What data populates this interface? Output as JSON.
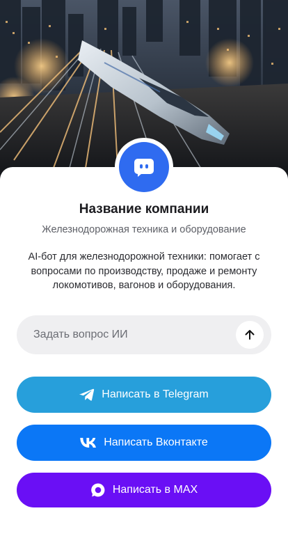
{
  "company": {
    "name": "Название компании",
    "subtitle": "Железнодорожная техника и оборудование",
    "description": "AI-бот для железнодорожной техники: помогает с вопросами по производству, продаже и ремонту локомотивов, вагонов и оборудования.",
    "avatar_icon": "chat-bot-icon"
  },
  "ask": {
    "placeholder": "Задать вопрос ИИ",
    "value": "",
    "send_icon": "arrow-up-icon"
  },
  "buttons": {
    "telegram": {
      "label": "Написать в Telegram",
      "icon": "telegram-icon",
      "color": "#279fdb"
    },
    "vk": {
      "label": "Написать Вконтакте",
      "icon": "vk-icon",
      "color": "#0b77f6"
    },
    "max": {
      "label": "Написать в MAX",
      "icon": "max-icon",
      "color": "#6a0ff5"
    }
  },
  "colors": {
    "avatar": "#2f6bf0",
    "input_bg": "#efeff1"
  },
  "hero_image": "high-speed train through city at night"
}
